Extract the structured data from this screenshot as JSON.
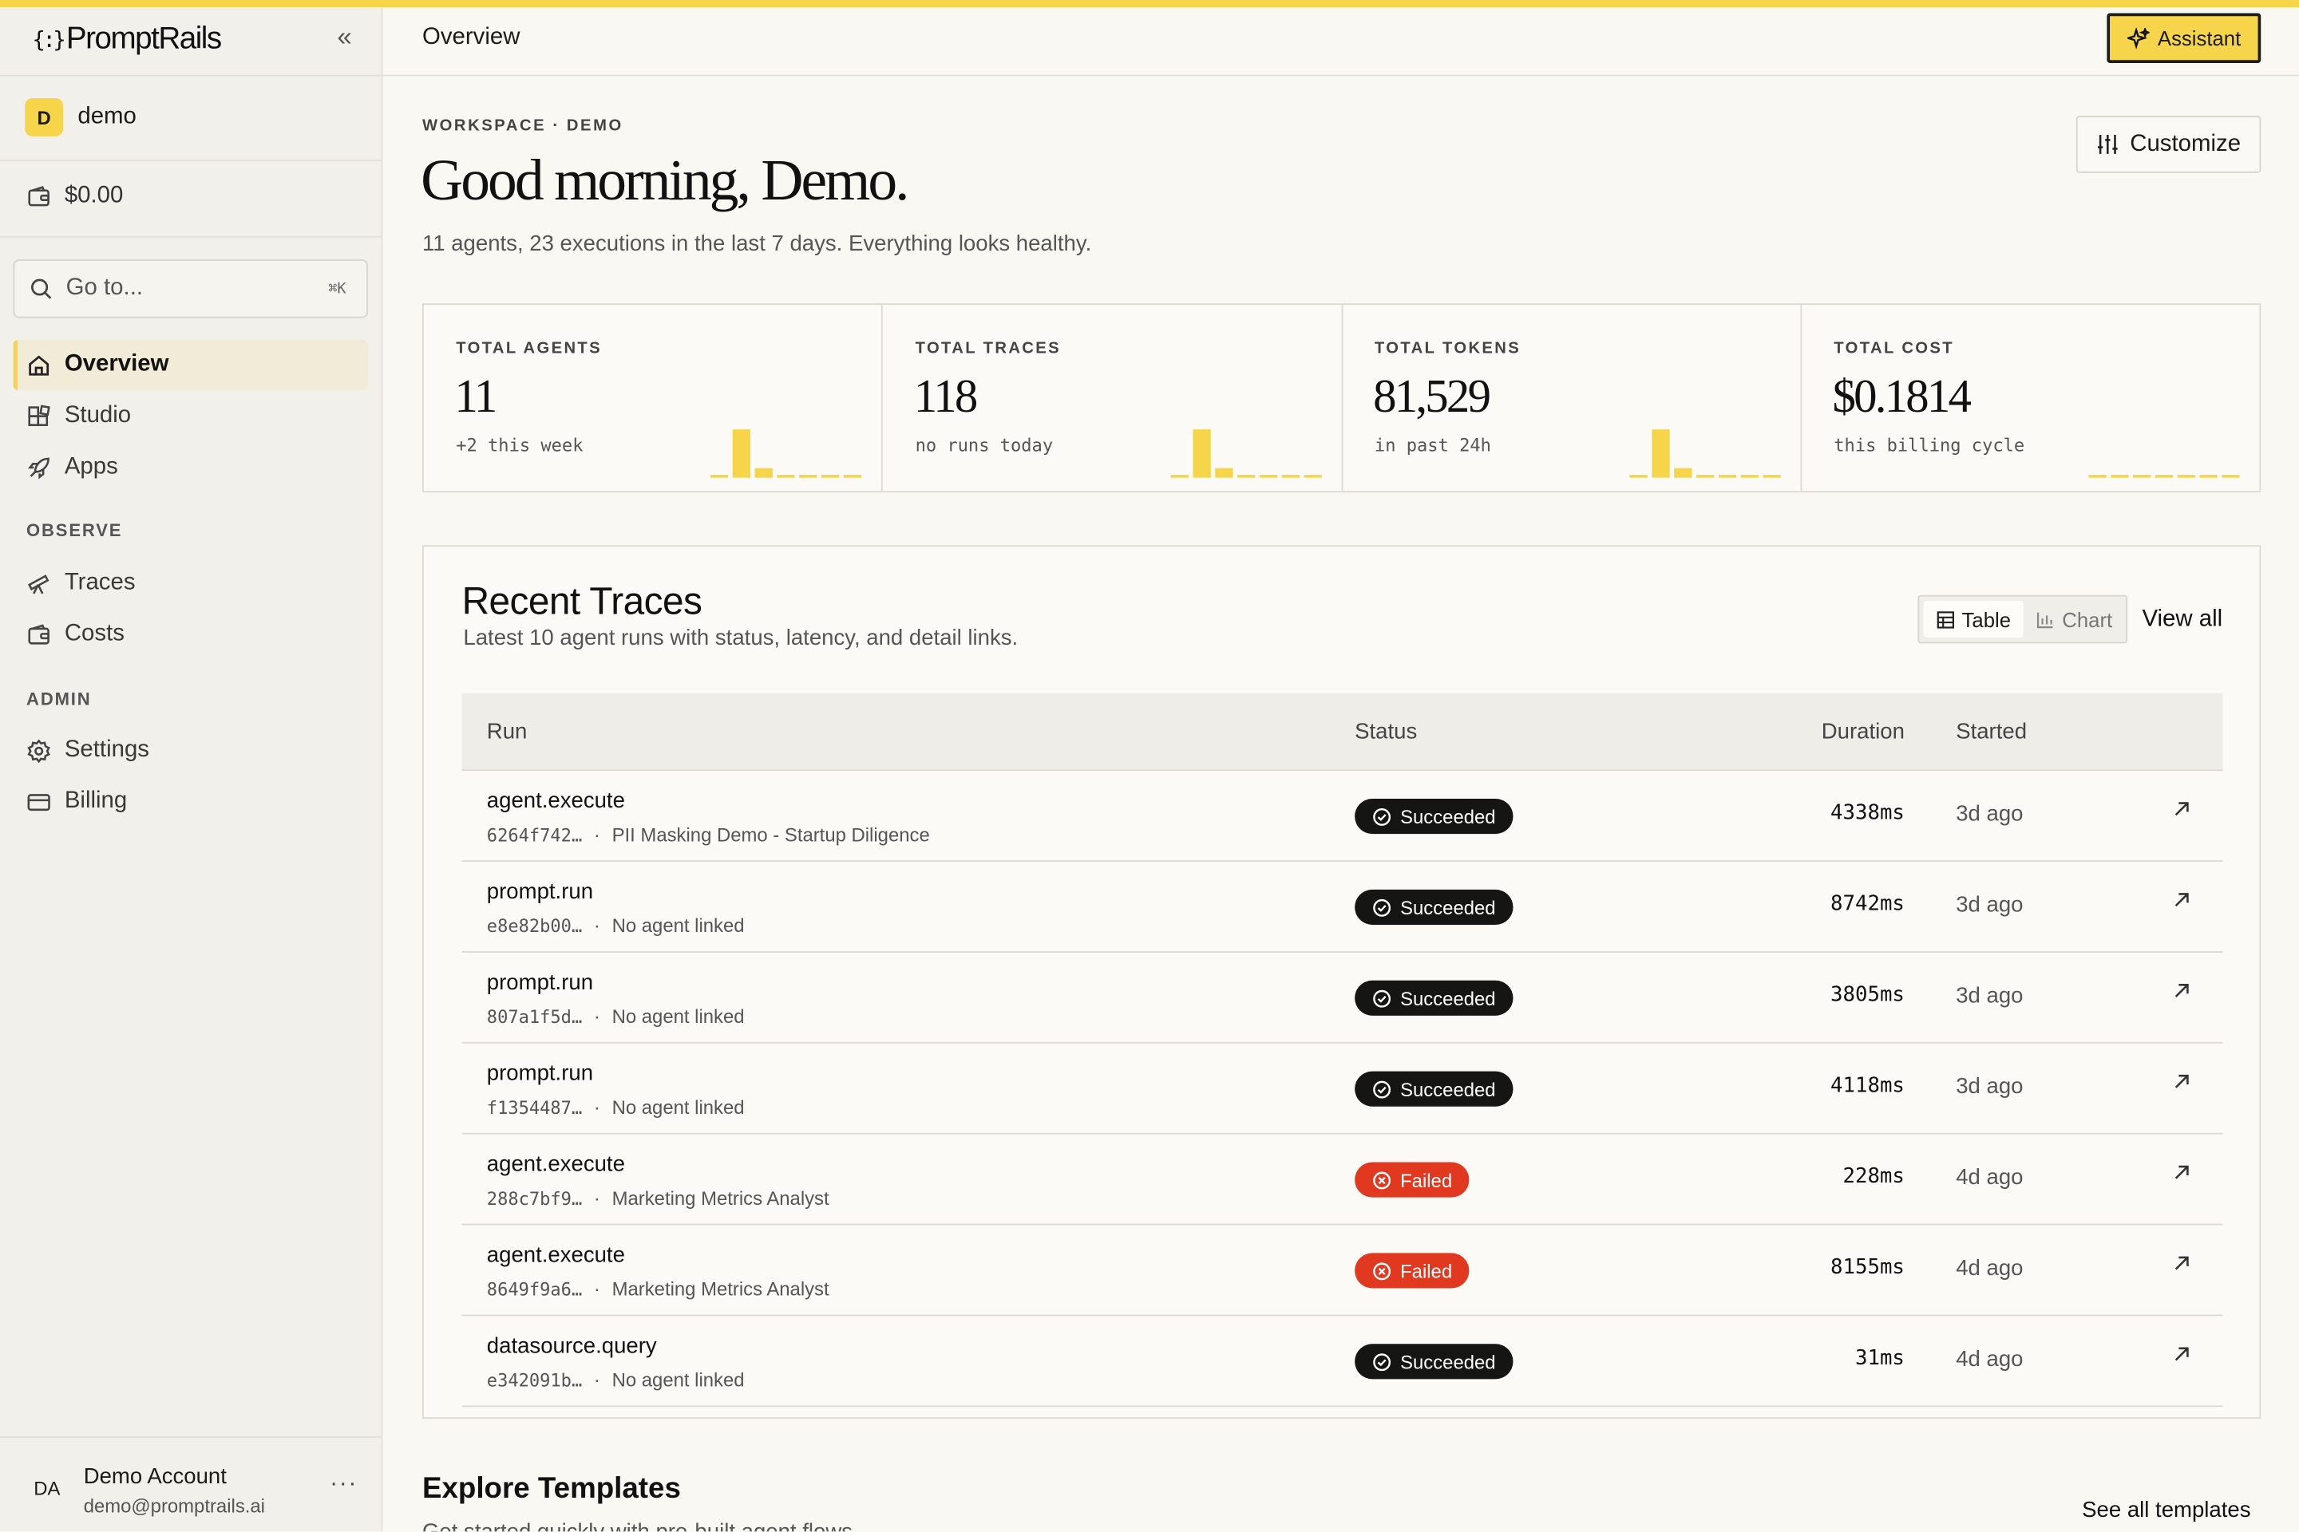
{
  "app": {
    "brand": "PromptRails",
    "workspace_initial": "D",
    "workspace_name": "demo",
    "balance": "$0.00",
    "search_placeholder": "Go to...",
    "search_shortcut": "⌘K",
    "accent_color": "#f7d54a"
  },
  "sidebar": {
    "main_items": [
      {
        "label": "Overview",
        "icon": "home-icon",
        "active": true
      },
      {
        "label": "Studio",
        "icon": "blocks-icon"
      },
      {
        "label": "Apps",
        "icon": "rocket-icon"
      }
    ],
    "observe_heading": "OBSERVE",
    "observe_items": [
      {
        "label": "Traces",
        "icon": "telescope-icon"
      },
      {
        "label": "Costs",
        "icon": "wallet-icon"
      }
    ],
    "admin_heading": "ADMIN",
    "admin_items": [
      {
        "label": "Settings",
        "icon": "gear-icon"
      },
      {
        "label": "Billing",
        "icon": "credit-card-icon"
      }
    ],
    "account": {
      "initials": "DA",
      "name": "Demo Account",
      "email": "demo@promptrails.ai",
      "more": "···"
    }
  },
  "header": {
    "title": "Overview",
    "assistant_label": "Assistant"
  },
  "overview": {
    "eyebrow": "WORKSPACE · DEMO",
    "greeting": "Good morning, Demo.",
    "subline": "11 agents, 23 executions in the last 7 days. Everything looks healthy.",
    "customize_label": "Customize"
  },
  "stats": [
    {
      "label": "TOTAL AGENTS",
      "value": "11",
      "note": "+2 this week",
      "spark": [
        0,
        1,
        0.2,
        0,
        0,
        0,
        0
      ]
    },
    {
      "label": "TOTAL TRACES",
      "value": "118",
      "note": "no runs today",
      "spark": [
        0,
        1,
        0.2,
        0,
        0,
        0,
        0
      ]
    },
    {
      "label": "TOTAL TOKENS",
      "value": "81,529",
      "note": "in past 24h",
      "spark": [
        0,
        1,
        0.2,
        0,
        0,
        0,
        0
      ]
    },
    {
      "label": "TOTAL COST",
      "value": "$0.1814",
      "note": "this billing cycle",
      "spark": [
        0,
        0,
        0,
        0,
        0,
        0,
        0
      ]
    }
  ],
  "traces": {
    "title": "Recent Traces",
    "subtitle": "Latest 10 agent runs with status, latency, and detail links.",
    "toggle_table": "Table",
    "toggle_chart": "Chart",
    "view_all": "View all",
    "columns": {
      "run": "Run",
      "status": "Status",
      "duration": "Duration",
      "started": "Started"
    },
    "rows": [
      {
        "name": "agent.execute",
        "id": "6264f742…",
        "agent": "PII Masking Demo - Startup Diligence",
        "status": "Succeeded",
        "ok": true,
        "duration": "4338ms",
        "started": "3d ago"
      },
      {
        "name": "prompt.run",
        "id": "e8e82b00…",
        "agent": "No agent linked",
        "status": "Succeeded",
        "ok": true,
        "duration": "8742ms",
        "started": "3d ago"
      },
      {
        "name": "prompt.run",
        "id": "807a1f5d…",
        "agent": "No agent linked",
        "status": "Succeeded",
        "ok": true,
        "duration": "3805ms",
        "started": "3d ago"
      },
      {
        "name": "prompt.run",
        "id": "f1354487…",
        "agent": "No agent linked",
        "status": "Succeeded",
        "ok": true,
        "duration": "4118ms",
        "started": "3d ago"
      },
      {
        "name": "agent.execute",
        "id": "288c7bf9…",
        "agent": "Marketing Metrics Analyst",
        "status": "Failed",
        "ok": false,
        "duration": "228ms",
        "started": "4d ago"
      },
      {
        "name": "agent.execute",
        "id": "8649f9a6…",
        "agent": "Marketing Metrics Analyst",
        "status": "Failed",
        "ok": false,
        "duration": "8155ms",
        "started": "4d ago"
      },
      {
        "name": "datasource.query",
        "id": "e342091b…",
        "agent": "No agent linked",
        "status": "Succeeded",
        "ok": true,
        "duration": "31ms",
        "started": "4d ago"
      }
    ]
  },
  "templates": {
    "title": "Explore Templates",
    "subtitle": "Get started quickly with pre-built agent flows.",
    "see_all": "See all templates"
  }
}
